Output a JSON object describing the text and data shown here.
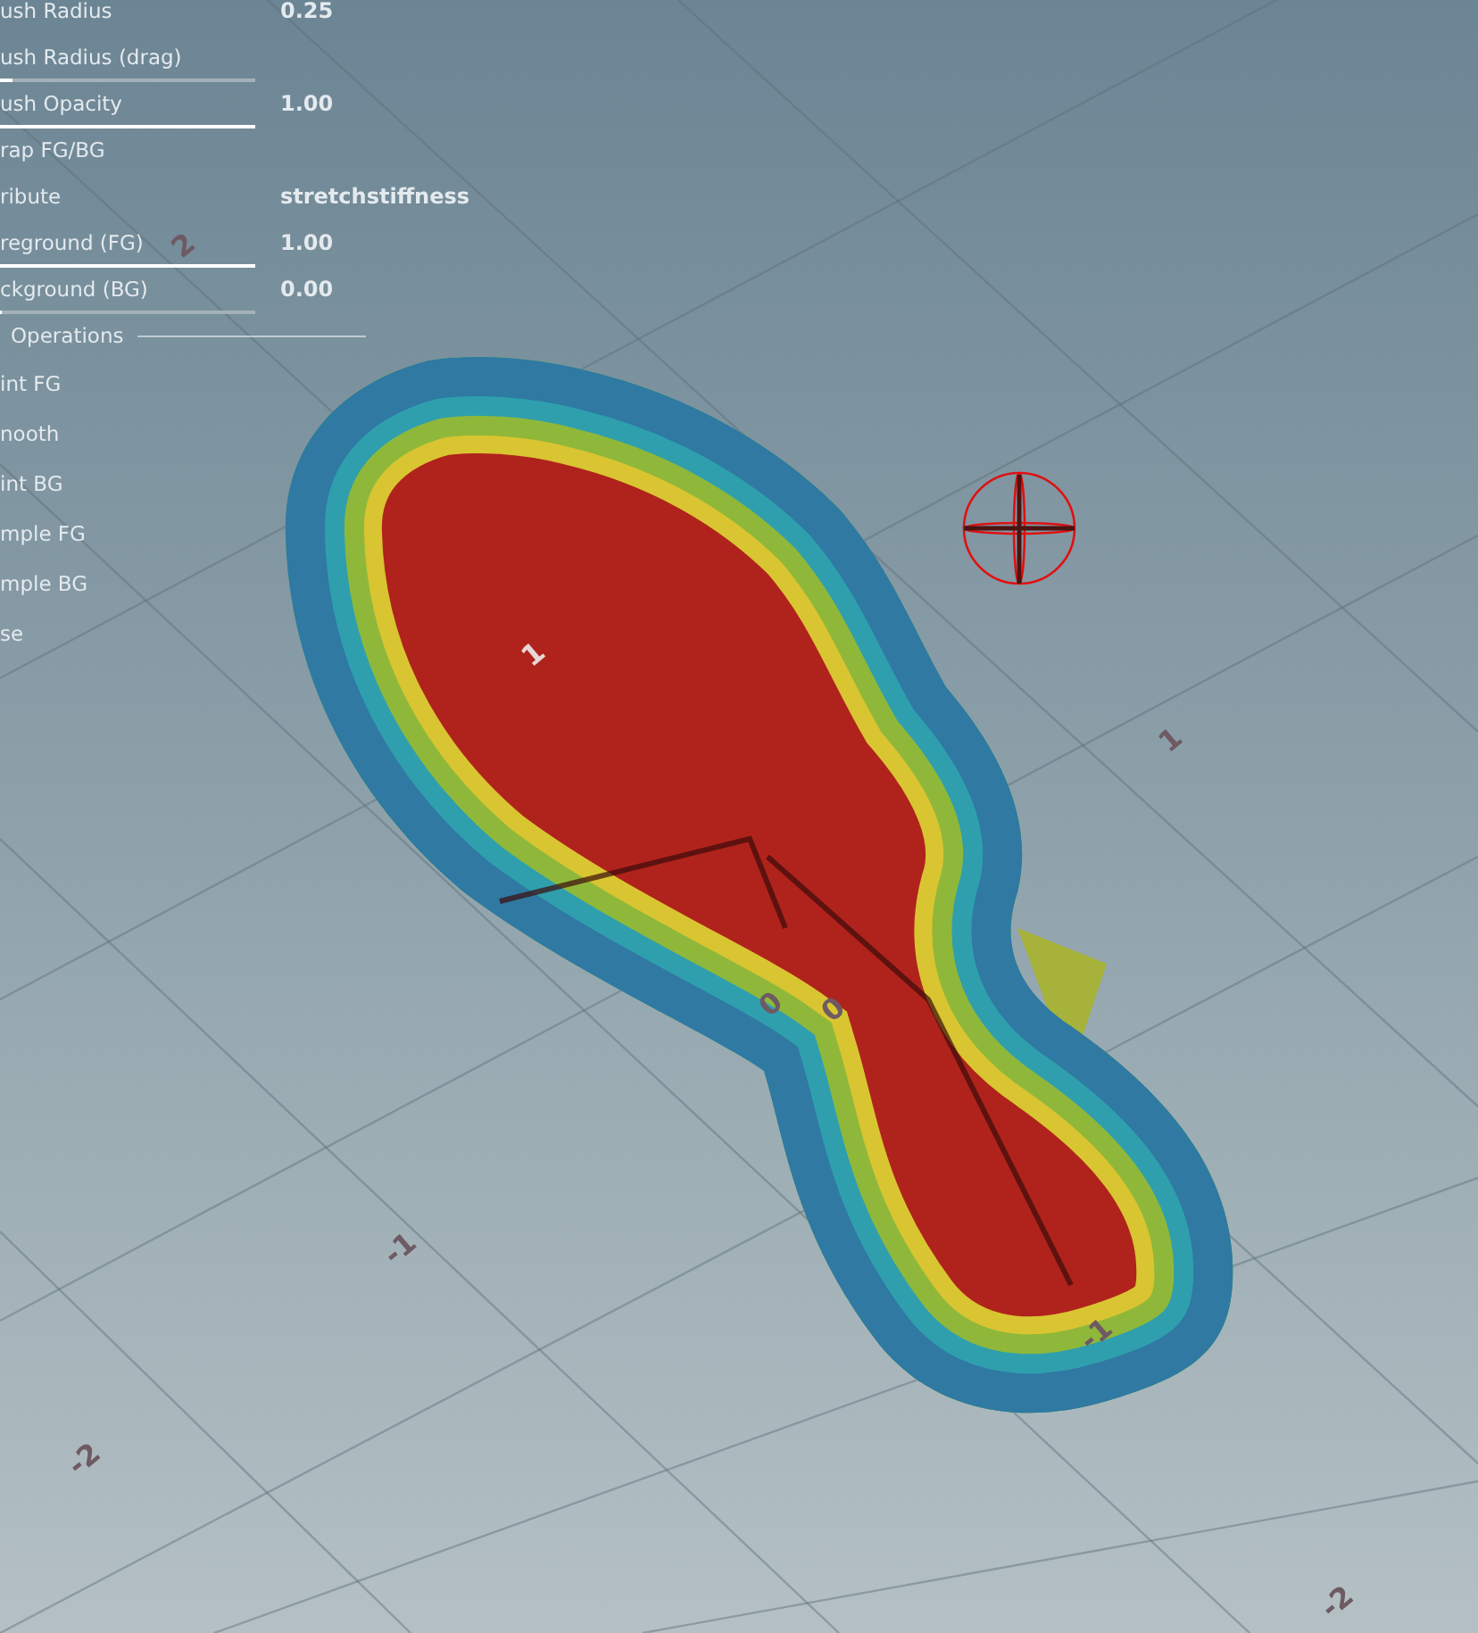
{
  "tool_panel": {
    "parameters": [
      {
        "label": "ush Radius",
        "value": "0.25",
        "kind": "plain"
      },
      {
        "label": "ush Radius (drag)",
        "kind": "slider",
        "level": 0.05
      },
      {
        "label": "ush Opacity",
        "value": "1.00",
        "kind": "slider",
        "level": 1
      },
      {
        "label": "rap FG/BG",
        "kind": "plain"
      },
      {
        "label": "ribute",
        "value": "stretchstiffness",
        "kind": "plain"
      },
      {
        "label": "reground (FG)",
        "value": "1.00",
        "kind": "slider",
        "level": 1
      },
      {
        "label": "ckground (BG)",
        "value": "0.00",
        "kind": "slider",
        "level": 0
      }
    ],
    "section": {
      "title": "Operations"
    },
    "operations": [
      "int FG",
      "nooth",
      "int BG",
      "mple FG",
      "mple BG",
      "se"
    ]
  },
  "viewport": {
    "grid_labels": [
      "2",
      "1",
      "1",
      "0",
      "0",
      "-1",
      "-1",
      "-2",
      "-2"
    ]
  }
}
